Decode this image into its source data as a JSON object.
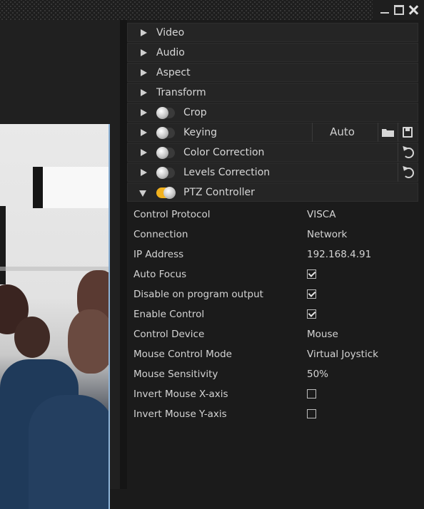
{
  "window": {
    "controls": [
      "minimize",
      "maximize",
      "close"
    ]
  },
  "sections": [
    {
      "label": "Video",
      "open": false
    },
    {
      "label": "Audio",
      "open": false
    },
    {
      "label": "Aspect",
      "open": false
    },
    {
      "label": "Transform",
      "open": false
    },
    {
      "label": "Crop",
      "open": false,
      "toggle": false
    },
    {
      "label": "Keying",
      "open": false,
      "toggle": false,
      "auto_label": "Auto"
    },
    {
      "label": "Color Correction",
      "open": false,
      "toggle": false
    },
    {
      "label": "Levels Correction",
      "open": false,
      "toggle": false
    },
    {
      "label": "PTZ Controller",
      "open": true,
      "toggle": true
    }
  ],
  "ptz_fields": [
    {
      "label": "Control Protocol",
      "value": "VISCA"
    },
    {
      "label": "Connection",
      "value": "Network"
    },
    {
      "label": "IP Address",
      "value": "192.168.4.91"
    },
    {
      "label": "Auto Focus",
      "checked": true
    },
    {
      "label": "Disable on program output",
      "checked": true
    },
    {
      "label": "Enable Control",
      "checked": true
    },
    {
      "label": "Control Device",
      "value": "Mouse"
    },
    {
      "label": "Mouse Control Mode",
      "value": "Virtual Joystick"
    },
    {
      "label": "Mouse Sensitivity",
      "value": "50%"
    },
    {
      "label": "Invert Mouse X-axis",
      "checked": false
    },
    {
      "label": "Invert Mouse Y-axis",
      "checked": false
    }
  ],
  "colors": {
    "toggle_on": "#f2b21e",
    "background": "#1b1b1b",
    "section_bg": "#252525"
  }
}
